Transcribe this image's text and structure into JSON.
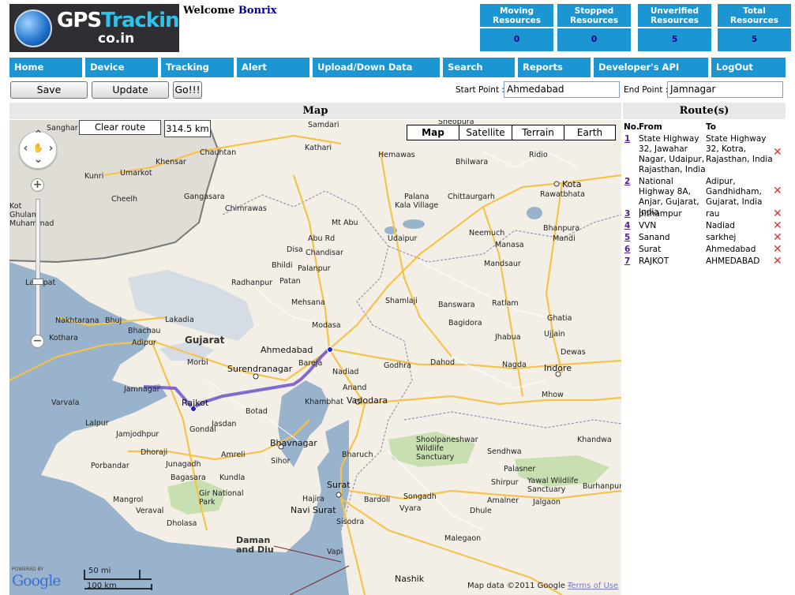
{
  "logo": {
    "text_a": "GPS",
    "text_b": "Tracking.",
    "text_c": "co.in"
  },
  "welcome": {
    "greeting": "Welcome",
    "user": "Bonrix"
  },
  "stats": [
    {
      "label": "Moving Resources",
      "value": "0"
    },
    {
      "label": "Stopped Resources",
      "value": "0"
    },
    {
      "label": "Unverified Resources",
      "value": "5"
    },
    {
      "label": "Total Resources",
      "value": "5"
    }
  ],
  "nav": [
    "Home",
    "Device",
    "Tracking",
    "Alert",
    "Upload/Down Data",
    "Search",
    "Reports",
    "Developer's API",
    "LogOut"
  ],
  "toolbar": {
    "save": "Save",
    "update": "Update",
    "go": "Go!!!",
    "start_label": "Start Point :",
    "start_value": "Ahmedabad",
    "end_label": "End Point :",
    "end_value": "Jamnagar"
  },
  "map": {
    "title": "Map",
    "clear_route": "Clear route",
    "distance": "314.5 km",
    "types": [
      "Map",
      "Satellite",
      "Terrain",
      "Earth"
    ],
    "scale_mi": "50 mi",
    "scale_km": "100 km",
    "powered": "POWERED BY",
    "google": "Google",
    "attribution": "Map data ©2011 Google -",
    "terms": "Terms of Use",
    "labels": [
      {
        "t": "Sheopura"
      },
      {
        "t": "Samdari"
      },
      {
        "t": "Chauhtan"
      },
      {
        "t": "Kathari"
      },
      {
        "t": "Hemawas"
      },
      {
        "t": "Khensar"
      },
      {
        "t": "Ridio"
      },
      {
        "t": "Bhilwara"
      },
      {
        "t": "Kota"
      },
      {
        "t": "Umarkot"
      },
      {
        "t": "Kunri"
      },
      {
        "t": "Cheelh"
      },
      {
        "t": "Gangasara"
      },
      {
        "t": "Chimrawas"
      },
      {
        "t": "Palana"
      },
      {
        "t": "Kala Village"
      },
      {
        "t": "Chittaurgarh"
      },
      {
        "t": "Rawatbhata"
      },
      {
        "t": "Mt Abu"
      },
      {
        "t": "Abu Rd"
      },
      {
        "t": "Udaipur"
      },
      {
        "t": "Neemuch"
      },
      {
        "t": "Bhanpura"
      },
      {
        "t": "Mandi"
      },
      {
        "t": "Disa"
      },
      {
        "t": "Chandisar"
      },
      {
        "t": "Bhildi"
      },
      {
        "t": "Palanpur"
      },
      {
        "t": "Mandsaur"
      },
      {
        "t": "Manasa"
      },
      {
        "t": "Radhanpur"
      },
      {
        "t": "Patan"
      },
      {
        "t": "Lakhpat"
      },
      {
        "t": "Mehsana"
      },
      {
        "t": "Shamlaji"
      },
      {
        "t": "Banswara"
      },
      {
        "t": "Ratlam"
      },
      {
        "t": "Nakhtarana"
      },
      {
        "t": "Bhuj"
      },
      {
        "t": "Bhachau"
      },
      {
        "t": "Lakadia"
      },
      {
        "t": "Modasa"
      },
      {
        "t": "Bagidora"
      },
      {
        "t": "Ghatia"
      },
      {
        "t": "Kothara"
      },
      {
        "t": "Adipur"
      },
      {
        "t": "Gujarat"
      },
      {
        "t": "Ahmedabad"
      },
      {
        "t": "Jhabua"
      },
      {
        "t": "Ujjain"
      },
      {
        "t": "Morbi"
      },
      {
        "t": "Bareja"
      },
      {
        "t": "Godhra"
      },
      {
        "t": "Dahod"
      },
      {
        "t": "Dewas"
      },
      {
        "t": "Surendranagar"
      },
      {
        "t": "Nadiad"
      },
      {
        "t": "Nagda"
      },
      {
        "t": "Indore"
      },
      {
        "t": "Jamnagar"
      },
      {
        "t": "Anand"
      },
      {
        "t": "Mhow"
      },
      {
        "t": "Varvala"
      },
      {
        "t": "Rajkot"
      },
      {
        "t": "Botad"
      },
      {
        "t": "Khambhat"
      },
      {
        "t": "Vadodara"
      },
      {
        "t": "Jasdan"
      },
      {
        "t": "Lalpur"
      },
      {
        "t": "Jamjodhpur"
      },
      {
        "t": "Gondal"
      },
      {
        "t": "Bhavnagar"
      },
      {
        "t": "Shoolpaneshwar Wildlife Sanctuary"
      },
      {
        "t": "Khandwa"
      },
      {
        "t": "Dhoraji"
      },
      {
        "t": "Amreli"
      },
      {
        "t": "Sihor"
      },
      {
        "t": "Bharuch"
      },
      {
        "t": "Sendhwa"
      },
      {
        "t": "Porbandar"
      },
      {
        "t": "Junagadh"
      },
      {
        "t": "Palasner"
      },
      {
        "t": "Bagasara"
      },
      {
        "t": "Kundla"
      },
      {
        "t": "Surat"
      },
      {
        "t": "Shirpur"
      },
      {
        "t": "Yawal Wildlife Sanctuary"
      },
      {
        "t": "Burhanpur"
      },
      {
        "t": "Mangrol"
      },
      {
        "t": "Gir National Park"
      },
      {
        "t": "Hajira"
      },
      {
        "t": "Bardoli"
      },
      {
        "t": "Songadh"
      },
      {
        "t": "Amalner"
      },
      {
        "t": "Jalgaon"
      },
      {
        "t": "Veraval"
      },
      {
        "t": "Navi Surat"
      },
      {
        "t": "Vyara"
      },
      {
        "t": "Dhule"
      },
      {
        "t": "Dholasa"
      },
      {
        "t": "Sisodra"
      },
      {
        "t": "Malegaon"
      },
      {
        "t": "Daman and Diu"
      },
      {
        "t": "Vapi"
      },
      {
        "t": "Nashik"
      },
      {
        "t": "Sanghar"
      },
      {
        "t": "Kot Ghulam Muhammad"
      }
    ]
  },
  "routes": {
    "title": "Route(s)",
    "head_no": "No.",
    "head_from": "From",
    "head_to": "To",
    "delete_icon": "✕",
    "items": [
      {
        "no": "1",
        "from": "State Highway 32, Jawahar Nagar, Udaipur, Rajasthan, India",
        "to": "State Highway 32, Kotra, Rajasthan, India"
      },
      {
        "no": "2",
        "from": "National Highway 8A, Anjar, Gujarat, India",
        "to": "Adipur, Gandhidham, Gujarat, India"
      },
      {
        "no": "3",
        "from": "pithampur",
        "to": "rau"
      },
      {
        "no": "4",
        "from": "VVN",
        "to": "Nadiad"
      },
      {
        "no": "5",
        "from": "Sanand",
        "to": "sarkhej"
      },
      {
        "no": "6",
        "from": "Surat",
        "to": "Ahmedabad"
      },
      {
        "no": "7",
        "from": "RAJKOT",
        "to": "AHMEDABAD"
      }
    ]
  }
}
